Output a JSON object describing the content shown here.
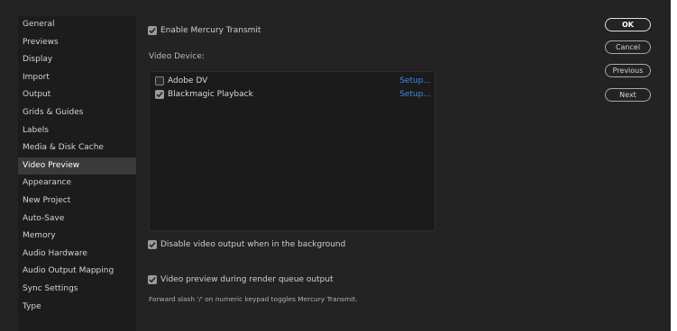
{
  "sidebar": {
    "items": [
      {
        "label": "General"
      },
      {
        "label": "Previews"
      },
      {
        "label": "Display"
      },
      {
        "label": "Import"
      },
      {
        "label": "Output"
      },
      {
        "label": "Grids & Guides"
      },
      {
        "label": "Labels"
      },
      {
        "label": "Media & Disk Cache"
      },
      {
        "label": "Video Preview",
        "selected": true
      },
      {
        "label": "Appearance"
      },
      {
        "label": "New Project"
      },
      {
        "label": "Auto-Save"
      },
      {
        "label": "Memory"
      },
      {
        "label": "Audio Hardware"
      },
      {
        "label": "Audio Output Mapping"
      },
      {
        "label": "Sync Settings"
      },
      {
        "label": "Type"
      }
    ]
  },
  "main": {
    "enable_mercury": {
      "label": "Enable Mercury Transmit",
      "checked": true
    },
    "video_device_label": "Video Device:",
    "devices": [
      {
        "name": "Adobe DV",
        "checked": false,
        "setup": "Setup..."
      },
      {
        "name": "Blackmagic Playback",
        "checked": true,
        "setup": "Setup..."
      }
    ],
    "disable_background": {
      "label": "Disable video output when in the background",
      "checked": true
    },
    "render_queue": {
      "label": "Video preview during render queue output",
      "checked": true
    },
    "hint": "Forward slash '/' on numeric keypad toggles Mercury Transmit."
  },
  "buttons": {
    "ok": "OK",
    "cancel": "Cancel",
    "previous": "Previous",
    "next": "Next"
  },
  "colors": {
    "background": "#232323",
    "sidebar": "#1c1c1c",
    "selected": "#3a3a3a",
    "link": "#3d8be8"
  }
}
